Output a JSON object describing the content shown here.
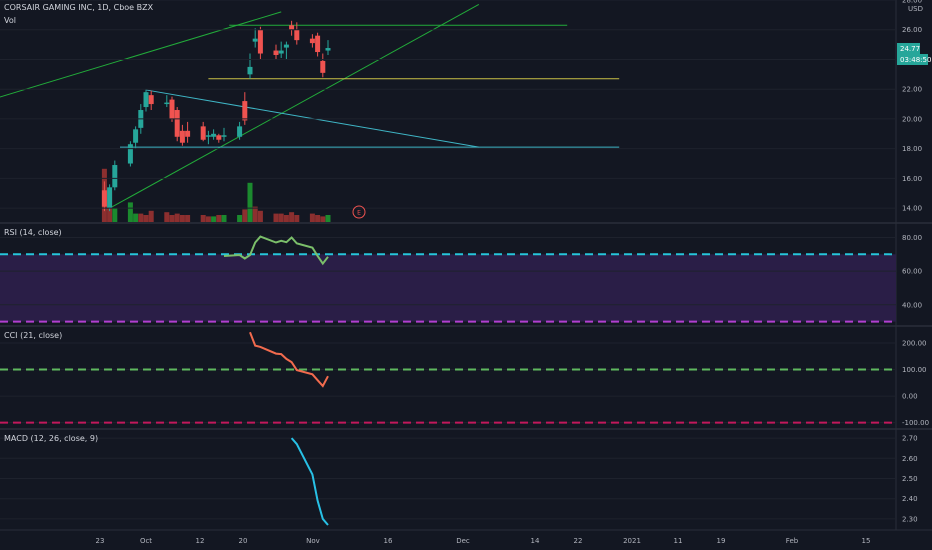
{
  "header": {
    "symbol_title": "CORSAIR GAMING INC, 1D, Cboe BZX",
    "volume_label": "Vol",
    "currency": "USD"
  },
  "earnings_marker": "E",
  "last_price_tag": "24.77",
  "countdown_tag": "03:48:50",
  "colors": {
    "background": "#131722",
    "up": "#26a69a",
    "down": "#ef5350",
    "volume_up": "#1b8a2e",
    "volume_down": "#8c2f2f",
    "channel": "#22ab3a",
    "trend_cyan": "#3fb6c6",
    "yellow_level": "#c9c046",
    "rsi_line": "#7bbf6a",
    "rsi_band": "#2a1e47",
    "cci_line": "#f26b4e",
    "macd_line": "#28c1e6",
    "dash_cyan": "#26c6da",
    "dash_purple": "#b13fd0",
    "dash_green": "#5fb85f",
    "dash_red": "#c2185b"
  },
  "chart_data": [
    {
      "type": "candlestick",
      "title": "CORSAIR GAMING INC, 1D, Cboe BZX",
      "ylabel": "USD",
      "ylim": [
        13,
        28
      ],
      "y_ticks": [
        14.0,
        16.0,
        18.0,
        20.0,
        22.0,
        24.0,
        26.0,
        28.0
      ],
      "x_labels": [
        "23",
        "Oct",
        "12",
        "20",
        "Nov",
        "16",
        "Dec",
        "14",
        "22",
        "2021",
        "11",
        "19",
        "Feb",
        "15"
      ],
      "candles": [
        {
          "date": "2020-09-23",
          "o": 15.2,
          "h": 15.8,
          "l": 13.8,
          "c": 14.1
        },
        {
          "date": "2020-09-24",
          "o": 14.0,
          "h": 15.6,
          "l": 13.8,
          "c": 15.4
        },
        {
          "date": "2020-09-25",
          "o": 15.4,
          "h": 17.2,
          "l": 15.2,
          "c": 16.9
        },
        {
          "date": "2020-09-28",
          "o": 17.0,
          "h": 18.5,
          "l": 16.8,
          "c": 18.3
        },
        {
          "date": "2020-09-29",
          "o": 18.4,
          "h": 19.5,
          "l": 18.0,
          "c": 19.3
        },
        {
          "date": "2020-09-30",
          "o": 19.4,
          "h": 21.0,
          "l": 19.0,
          "c": 20.6
        },
        {
          "date": "2020-10-01",
          "o": 20.8,
          "h": 22.0,
          "l": 20.5,
          "c": 21.8
        },
        {
          "date": "2020-10-02",
          "o": 21.6,
          "h": 21.9,
          "l": 20.6,
          "c": 21.0
        },
        {
          "date": "2020-10-05",
          "o": 21.0,
          "h": 21.6,
          "l": 20.8,
          "c": 21.1
        },
        {
          "date": "2020-10-06",
          "o": 21.3,
          "h": 21.5,
          "l": 19.8,
          "c": 20.0
        },
        {
          "date": "2020-10-07",
          "o": 20.6,
          "h": 20.8,
          "l": 18.5,
          "c": 18.8
        },
        {
          "date": "2020-10-08",
          "o": 19.2,
          "h": 19.6,
          "l": 18.2,
          "c": 18.4
        },
        {
          "date": "2020-10-09",
          "o": 19.2,
          "h": 19.8,
          "l": 18.4,
          "c": 18.8
        },
        {
          "date": "2020-10-12",
          "o": 19.5,
          "h": 19.8,
          "l": 18.5,
          "c": 18.6
        },
        {
          "date": "2020-10-13",
          "o": 18.8,
          "h": 19.2,
          "l": 18.3,
          "c": 18.9
        },
        {
          "date": "2020-10-14",
          "o": 18.8,
          "h": 19.3,
          "l": 18.6,
          "c": 19.0
        },
        {
          "date": "2020-10-15",
          "o": 18.9,
          "h": 19.0,
          "l": 18.4,
          "c": 18.6
        },
        {
          "date": "2020-10-16",
          "o": 18.8,
          "h": 19.4,
          "l": 18.5,
          "c": 18.9
        },
        {
          "date": "2020-10-19",
          "o": 18.8,
          "h": 19.8,
          "l": 18.6,
          "c": 19.5
        },
        {
          "date": "2020-10-20",
          "o": 21.2,
          "h": 21.8,
          "l": 19.6,
          "c": 19.9
        },
        {
          "date": "2020-10-21",
          "o": 23.0,
          "h": 24.4,
          "l": 22.7,
          "c": 23.5
        },
        {
          "date": "2020-10-22",
          "o": 25.2,
          "h": 26.1,
          "l": 24.8,
          "c": 25.4
        },
        {
          "date": "2020-10-23",
          "o": 26.0,
          "h": 26.2,
          "l": 24.0,
          "c": 24.4
        },
        {
          "date": "2020-10-26",
          "o": 24.6,
          "h": 25.0,
          "l": 24.0,
          "c": 24.3
        },
        {
          "date": "2020-10-27",
          "o": 24.4,
          "h": 25.2,
          "l": 24.1,
          "c": 24.6
        },
        {
          "date": "2020-10-28",
          "o": 24.8,
          "h": 25.2,
          "l": 24.0,
          "c": 25.0
        },
        {
          "date": "2020-10-29",
          "o": 26.3,
          "h": 26.6,
          "l": 25.6,
          "c": 26.0
        },
        {
          "date": "2020-10-30",
          "o": 26.0,
          "h": 26.5,
          "l": 25.0,
          "c": 25.3
        },
        {
          "date": "2020-11-02",
          "o": 25.4,
          "h": 25.7,
          "l": 24.8,
          "c": 25.1
        },
        {
          "date": "2020-11-03",
          "o": 25.6,
          "h": 25.8,
          "l": 24.2,
          "c": 24.5
        },
        {
          "date": "2020-11-04",
          "o": 23.9,
          "h": 24.4,
          "l": 22.8,
          "c": 23.1
        },
        {
          "date": "2020-11-05",
          "o": 24.6,
          "h": 25.3,
          "l": 24.3,
          "c": 24.77
        }
      ],
      "volume": [
        {
          "date": "2020-09-23",
          "v": 3.8,
          "dir": "down"
        },
        {
          "date": "2020-09-24",
          "v": 2.2,
          "dir": "down"
        },
        {
          "date": "2020-09-25",
          "v": 1.0,
          "dir": "up"
        },
        {
          "date": "2020-09-28",
          "v": 1.4,
          "dir": "up"
        },
        {
          "date": "2020-09-29",
          "v": 0.6,
          "dir": "up"
        },
        {
          "date": "2020-09-30",
          "v": 0.6,
          "dir": "down"
        },
        {
          "date": "2020-10-01",
          "v": 0.5,
          "dir": "down"
        },
        {
          "date": "2020-10-02",
          "v": 0.8,
          "dir": "down"
        },
        {
          "date": "2020-10-05",
          "v": 0.7,
          "dir": "down"
        },
        {
          "date": "2020-10-06",
          "v": 0.5,
          "dir": "down"
        },
        {
          "date": "2020-10-07",
          "v": 0.6,
          "dir": "down"
        },
        {
          "date": "2020-10-08",
          "v": 0.5,
          "dir": "down"
        },
        {
          "date": "2020-10-09",
          "v": 0.5,
          "dir": "down"
        },
        {
          "date": "2020-10-12",
          "v": 0.5,
          "dir": "down"
        },
        {
          "date": "2020-10-13",
          "v": 0.4,
          "dir": "down"
        },
        {
          "date": "2020-10-14",
          "v": 0.4,
          "dir": "up"
        },
        {
          "date": "2020-10-15",
          "v": 0.5,
          "dir": "down"
        },
        {
          "date": "2020-10-16",
          "v": 0.5,
          "dir": "up"
        },
        {
          "date": "2020-10-19",
          "v": 0.5,
          "dir": "up"
        },
        {
          "date": "2020-10-20",
          "v": 0.9,
          "dir": "down"
        },
        {
          "date": "2020-10-21",
          "v": 2.8,
          "dir": "up"
        },
        {
          "date": "2020-10-22",
          "v": 1.1,
          "dir": "down"
        },
        {
          "date": "2020-10-23",
          "v": 0.8,
          "dir": "down"
        },
        {
          "date": "2020-10-26",
          "v": 0.6,
          "dir": "down"
        },
        {
          "date": "2020-10-27",
          "v": 0.6,
          "dir": "down"
        },
        {
          "date": "2020-10-28",
          "v": 0.5,
          "dir": "down"
        },
        {
          "date": "2020-10-29",
          "v": 0.7,
          "dir": "down"
        },
        {
          "date": "2020-10-30",
          "v": 0.5,
          "dir": "down"
        },
        {
          "date": "2020-11-02",
          "v": 0.6,
          "dir": "down"
        },
        {
          "date": "2020-11-03",
          "v": 0.5,
          "dir": "down"
        },
        {
          "date": "2020-11-04",
          "v": 0.4,
          "dir": "down"
        },
        {
          "date": "2020-11-05",
          "v": 0.5,
          "dir": "up"
        }
      ],
      "drawings": [
        {
          "kind": "channel-lower",
          "from": {
            "date": "2020-09-23",
            "price": 13.8
          },
          "to": {
            "date": "2020-12-04",
            "price": 27.7
          }
        },
        {
          "kind": "channel-upper",
          "from": {
            "date": "2020-08-03",
            "price": 18.2
          },
          "to": {
            "date": "2020-10-27",
            "price": 27.2
          }
        },
        {
          "kind": "resistance",
          "from": {
            "date": "2020-10-17",
            "price": 26.3
          },
          "to": {
            "date": "2020-12-21",
            "price": 26.3
          }
        },
        {
          "kind": "level",
          "from": {
            "date": "2020-10-13",
            "price": 22.7
          },
          "to": {
            "date": "2020-12-31",
            "price": 22.7
          }
        },
        {
          "kind": "support",
          "from": {
            "date": "2020-09-26",
            "price": 18.1
          },
          "to": {
            "date": "2020-12-31",
            "price": 18.1
          }
        },
        {
          "kind": "descending",
          "from": {
            "date": "2020-10-01",
            "price": 21.95
          },
          "to": {
            "date": "2020-12-04",
            "price": 18.1
          }
        }
      ]
    },
    {
      "type": "line",
      "title": "RSI (14, close)",
      "ylim": [
        28,
        88
      ],
      "y_ticks": [
        40.0,
        60.0,
        80.0
      ],
      "reference_lines": [
        70,
        30
      ],
      "band": [
        30,
        70
      ],
      "x": [
        "2020-10-16",
        "2020-10-19",
        "2020-10-20",
        "2020-10-21",
        "2020-10-22",
        "2020-10-23",
        "2020-10-26",
        "2020-10-27",
        "2020-10-28",
        "2020-10-29",
        "2020-10-30",
        "2020-11-02",
        "2020-11-03",
        "2020-11-04",
        "2020-11-05"
      ],
      "values": [
        69.0,
        69.6,
        67.5,
        69.5,
        77.0,
        80.5,
        77.0,
        78.0,
        77.2,
        80.0,
        76.5,
        74.0,
        69.0,
        64.5,
        68.5
      ]
    },
    {
      "type": "line",
      "title": "CCI (21, close)",
      "ylim": [
        -120,
        260
      ],
      "y_ticks": [
        -100.0,
        0.0,
        100.0,
        200.0
      ],
      "reference_lines": [
        100,
        -100
      ],
      "x": [
        "2020-10-21",
        "2020-10-22",
        "2020-10-23",
        "2020-10-26",
        "2020-10-27",
        "2020-10-28",
        "2020-10-29",
        "2020-10-30",
        "2020-11-02",
        "2020-11-03",
        "2020-11-04",
        "2020-11-05"
      ],
      "values": [
        240,
        190,
        185,
        160,
        158,
        140,
        128,
        98,
        82,
        60,
        38,
        75
      ]
    },
    {
      "type": "line",
      "title": "MACD (12, 26, close, 9)",
      "ylim": [
        2.25,
        2.74
      ],
      "y_ticks": [
        2.3,
        2.4,
        2.5,
        2.6,
        2.7
      ],
      "x": [
        "2020-10-29",
        "2020-10-30",
        "2020-11-02",
        "2020-11-03",
        "2020-11-04",
        "2020-11-05"
      ],
      "values": [
        2.7,
        2.67,
        2.52,
        2.39,
        2.3,
        2.27
      ]
    }
  ]
}
